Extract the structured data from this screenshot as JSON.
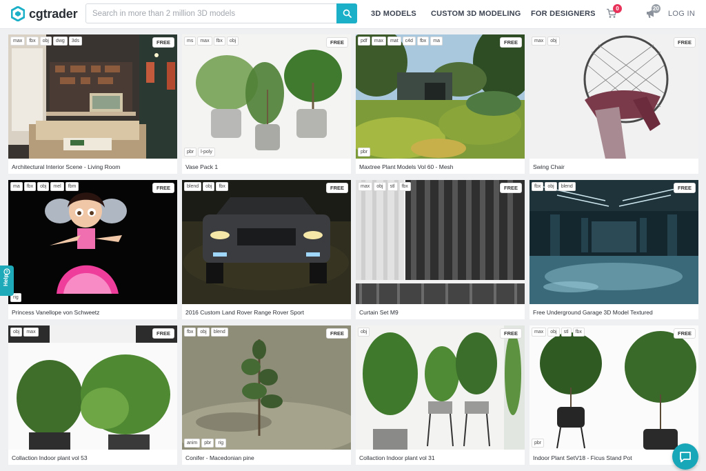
{
  "brand": {
    "name": "cgtrader",
    "color": "#1bb0c7"
  },
  "search": {
    "placeholder": "Search in more than 2 million 3D models",
    "value": ""
  },
  "nav": {
    "models": "3D MODELS",
    "custom": "CUSTOM 3D MODELING",
    "designers": "FOR DESIGNERS",
    "cart_count": "0",
    "notifications_count": "20",
    "login": "LOG IN"
  },
  "help_label": "Help",
  "products": [
    {
      "title": "Architectural Interior Scene - Living Room",
      "formats": [
        "max",
        "fbx",
        "obj",
        "dwg",
        "3ds"
      ],
      "badge": "FREE",
      "extra_tags": []
    },
    {
      "title": "Vase Pack 1",
      "formats": [
        "ms",
        "max",
        "fbx",
        "obj"
      ],
      "badge": "FREE",
      "extra_tags": [
        "pbr",
        "l-poly"
      ]
    },
    {
      "title": "Maxtree Plant Models Vol 60 - Mesh",
      "formats": [
        "pdf",
        "max",
        "mat",
        "c4d",
        "fbx",
        "ma"
      ],
      "badge": "FREE",
      "extra_tags": [
        "pbr"
      ]
    },
    {
      "title": "Swing Chair",
      "formats": [
        "max",
        "obj"
      ],
      "badge": "FREE",
      "extra_tags": []
    },
    {
      "title": "Princess Vanellope von Schweetz",
      "formats": [
        "ma",
        "fbx",
        "obj",
        "mel",
        "fbm"
      ],
      "badge": "FREE",
      "extra_tags": [
        "rig"
      ]
    },
    {
      "title": "2016 Custom Land Rover Range Rover Sport",
      "formats": [
        "blend",
        "obj",
        "fbx"
      ],
      "badge": "FREE",
      "extra_tags": []
    },
    {
      "title": "Curtain Set M9",
      "formats": [
        "max",
        "obj",
        "stl",
        "fbx"
      ],
      "badge": "FREE",
      "extra_tags": []
    },
    {
      "title": "Free Underground Garage 3D Model Textured",
      "formats": [
        "fbx",
        "obj",
        "blend"
      ],
      "badge": "FREE",
      "extra_tags": []
    },
    {
      "title": "Collaction Indoor plant vol 53",
      "formats": [
        "obj",
        "max"
      ],
      "badge": "FREE",
      "extra_tags": []
    },
    {
      "title": "Conifer - Macedonian pine",
      "formats": [
        "fbx",
        "obj",
        "blend"
      ],
      "badge": "FREE",
      "extra_tags": [
        "anim",
        "pbr",
        "rig"
      ]
    },
    {
      "title": "Collaction Indoor plant vol 31",
      "formats": [
        "obj"
      ],
      "badge": "FREE",
      "extra_tags": []
    },
    {
      "title": "Indoor Plant SetV18 - Ficus Stand Pot",
      "formats": [
        "max",
        "obj",
        "stl",
        "fbx"
      ],
      "badge": "FREE",
      "extra_tags": [
        "pbr"
      ]
    }
  ]
}
